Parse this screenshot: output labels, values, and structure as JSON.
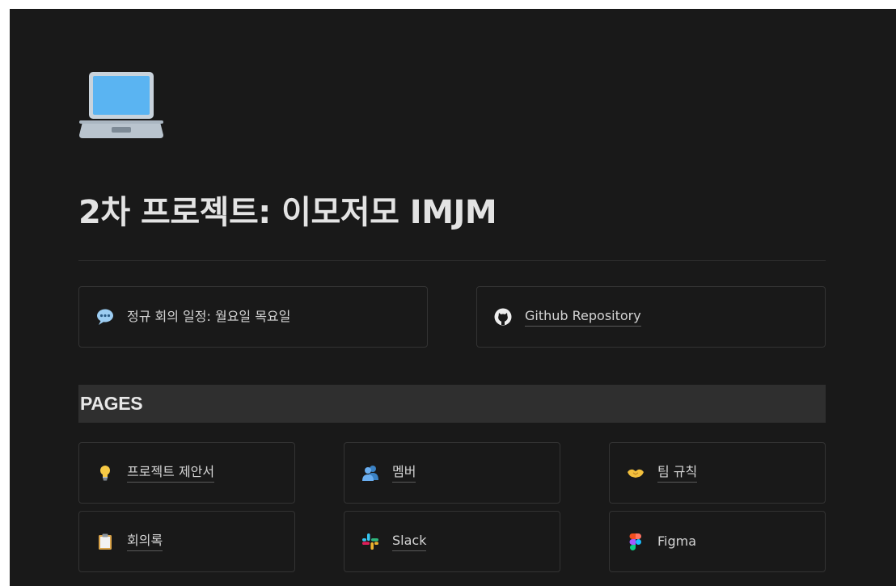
{
  "page": {
    "title": "2차 프로젝트: 이모저모 IMJM",
    "icon": "laptop-icon"
  },
  "callouts": [
    {
      "label": "정규 회의 일정: 월요일 목요일",
      "icon": "speech-bubble-icon"
    },
    {
      "label": "Github Repository",
      "icon": "github-icon"
    }
  ],
  "pages_section": {
    "heading": "PAGES",
    "items": [
      {
        "label": "프로젝트 제안서",
        "icon": "lightbulb-icon"
      },
      {
        "label": "멤버",
        "icon": "people-icon"
      },
      {
        "label": "팀 규칙",
        "icon": "handshake-icon"
      },
      {
        "label": "회의록",
        "icon": "clipboard-icon"
      },
      {
        "label": "Slack",
        "icon": "slack-icon"
      },
      {
        "label": "Figma",
        "icon": "figma-icon"
      }
    ]
  },
  "colors": {
    "background": "#191919",
    "text": "#e3e3e3",
    "border": "#333333",
    "header_bg": "#2f2f2f"
  }
}
